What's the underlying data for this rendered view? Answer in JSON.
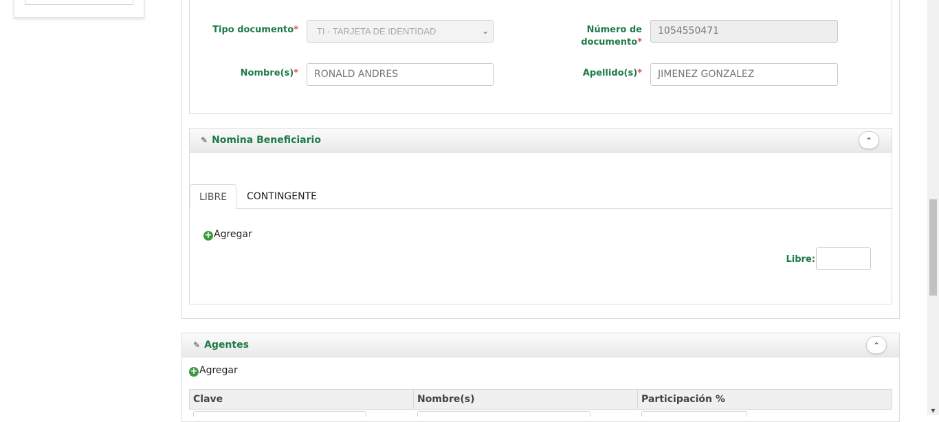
{
  "beneficiary_form": {
    "tipo_documento_label": "Tipo documento",
    "tipo_documento_value": "TI - TARJETA DE IDENTIDAD",
    "numero_documento_label_line1": "Número de",
    "numero_documento_label_line2": "documento",
    "numero_documento_value": "1054550471",
    "nombres_label": "Nombre(s)",
    "nombres_value": "RONALD ANDRES",
    "apellidos_label": "Apellido(s)",
    "apellidos_value": "JIMENEZ GONZALEZ",
    "required_mark": "*"
  },
  "nomina": {
    "title": "Nomina Beneficiario",
    "tabs": [
      {
        "label": "LIBRE",
        "active": true
      },
      {
        "label": "CONTINGENTE",
        "active": false
      }
    ],
    "add_label": "Agregar",
    "libre_label": "Libre:",
    "libre_value": ""
  },
  "agentes": {
    "title": "Agentes",
    "add_label": "Agregar",
    "columns": [
      "Clave",
      "Nombre(s)",
      "Participación %"
    ]
  },
  "icons": {
    "edit": "edit-icon",
    "collapse": "chevron-up-icon",
    "add": "plus-circle-icon",
    "select_arrow": "chevron-down-icon"
  },
  "colors": {
    "label_green": "#1e7a46",
    "required_red": "#d9534f",
    "plus_green": "#3a9a3a"
  }
}
